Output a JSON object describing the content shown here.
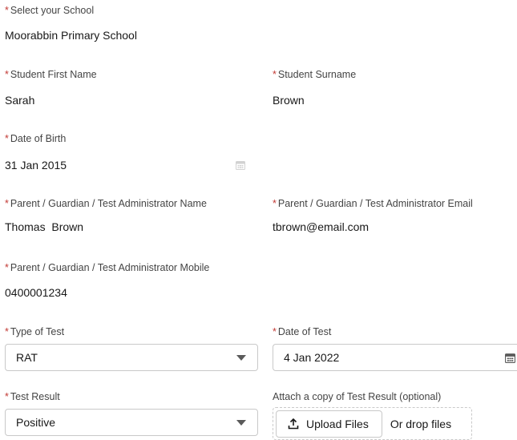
{
  "required_marker": "*",
  "school": {
    "label": "Select your School",
    "value": "Moorabbin Primary School"
  },
  "first_name": {
    "label": "Student First Name",
    "value": "Sarah"
  },
  "surname": {
    "label": "Student Surname",
    "value": "Brown"
  },
  "dob": {
    "label": "Date of Birth",
    "value": "31 Jan 2015",
    "icon": "calendar-icon"
  },
  "guardian_name": {
    "label": "Parent / Guardian / Test Administrator Name",
    "value": "Thomas  Brown"
  },
  "guardian_email": {
    "label": "Parent / Guardian / Test Administrator Email",
    "value": "tbrown@email.com"
  },
  "guardian_mobile": {
    "label": "Parent / Guardian / Test Administrator Mobile",
    "value": "0400001234"
  },
  "test_type": {
    "label": "Type of Test",
    "value": "RAT",
    "icon": "chevron-down-icon"
  },
  "test_date": {
    "label": "Date of Test",
    "value": "4 Jan 2022",
    "icon": "calendar-icon"
  },
  "test_result": {
    "label": "Test Result",
    "value": "Positive",
    "icon": "chevron-down-icon"
  },
  "attachment": {
    "label": "Attach a copy of Test Result (optional)",
    "button_label": "Upload Files",
    "drop_label": "Or drop files",
    "icon": "upload-icon"
  },
  "colors": {
    "required": "#c23934",
    "label": "#444444",
    "border": "#c9c9c9",
    "text": "#181818"
  }
}
